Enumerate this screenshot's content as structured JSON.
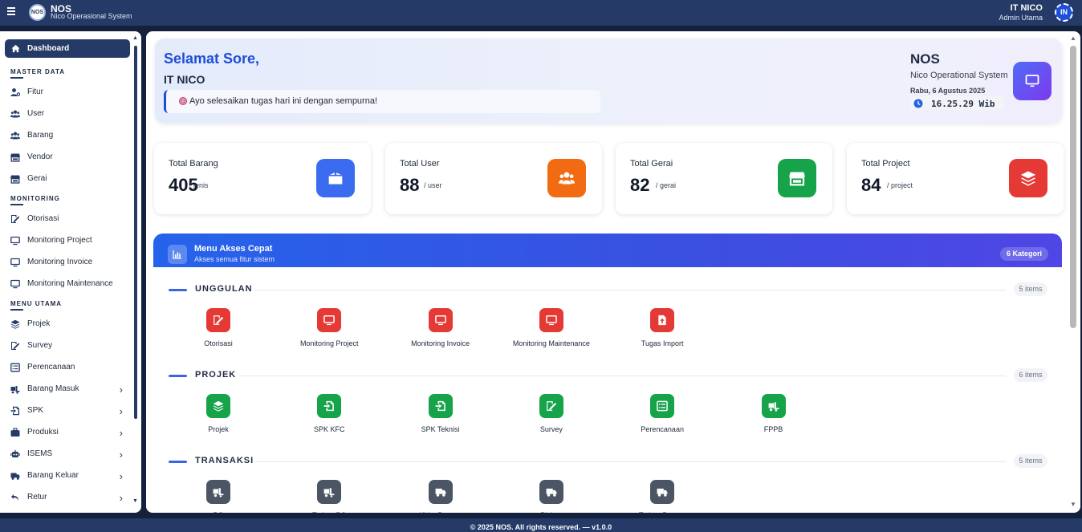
{
  "topbar": {
    "app_name": "NOS",
    "app_subtitle": "Nico Operasional System",
    "logo_text": "NOS",
    "user_name": "IT NICO",
    "user_role": "Admin Utama",
    "avatar_initials": "IN"
  },
  "sidebar": {
    "active": {
      "label": "Dashboard",
      "icon": "home-icon"
    },
    "sections": [
      {
        "title": "MASTER DATA",
        "items": [
          {
            "label": "Fitur",
            "icon": "user-cog-icon"
          },
          {
            "label": "User",
            "icon": "users-icon"
          },
          {
            "label": "Barang",
            "icon": "users-icon"
          },
          {
            "label": "Vendor",
            "icon": "store-icon"
          },
          {
            "label": "Gerai",
            "icon": "store-icon"
          }
        ]
      },
      {
        "title": "MONITORING",
        "items": [
          {
            "label": "Otorisasi",
            "icon": "signature-icon"
          },
          {
            "label": "Monitoring Project",
            "icon": "monitor-icon"
          },
          {
            "label": "Monitoring Invoice",
            "icon": "monitor-icon"
          },
          {
            "label": "Monitoring Maintenance",
            "icon": "monitor-icon"
          }
        ]
      },
      {
        "title": "MENU UTAMA",
        "items": [
          {
            "label": "Projek",
            "icon": "layers-icon"
          },
          {
            "label": "Survey",
            "icon": "signature-icon"
          },
          {
            "label": "Perencanaan",
            "icon": "list-icon"
          },
          {
            "label": "Barang Masuk",
            "icon": "truck-loading-icon",
            "expandable": true
          },
          {
            "label": "SPK",
            "icon": "file-import-icon",
            "expandable": true
          },
          {
            "label": "Produksi",
            "icon": "briefcase-icon",
            "expandable": true
          },
          {
            "label": "ISEMS",
            "icon": "robot-icon",
            "expandable": true
          },
          {
            "label": "Barang Keluar",
            "icon": "truck-icon",
            "expandable": true
          },
          {
            "label": "Retur",
            "icon": "undo-icon",
            "expandable": true
          }
        ]
      }
    ]
  },
  "welcome": {
    "greeting": "Selamat Sore,",
    "user": "IT NICO",
    "message": "Ayo selesaikan tugas hari ini dengan sempurna!",
    "system_short": "NOS",
    "system_name": "Nico Operational System",
    "date": "Rabu, 6 Agustus 2025",
    "time": "16.25.29 Wib"
  },
  "stats": [
    {
      "label": "Total Barang",
      "value": "405",
      "unit": "/ jenis",
      "color": "#3b6cf0",
      "icon": "box-icon"
    },
    {
      "label": "Total User",
      "value": "88",
      "unit": "/ user",
      "color": "#f26b12",
      "icon": "users-icon"
    },
    {
      "label": "Total Gerai",
      "value": "82",
      "unit": "/ gerai",
      "color": "#16a34a",
      "icon": "store-icon"
    },
    {
      "label": "Total Project",
      "value": "84",
      "unit": "/ project",
      "color": "#e53935",
      "icon": "layers-icon"
    }
  ],
  "quick_access": {
    "title": "Menu Akses Cepat",
    "subtitle": "Akses semua fitur sistem",
    "badge": "6 Kategori",
    "categories": [
      {
        "title": "UNGGULAN",
        "count": "5 items",
        "color": "red",
        "items": [
          {
            "label": "Otorisasi",
            "icon": "signature-icon"
          },
          {
            "label": "Monitoring Project",
            "icon": "monitor-icon"
          },
          {
            "label": "Monitoring Invoice",
            "icon": "monitor-icon"
          },
          {
            "label": "Monitoring Maintenance",
            "icon": "monitor-icon"
          },
          {
            "label": "Tugas Import",
            "icon": "file-upload-icon"
          }
        ]
      },
      {
        "title": "PROJEK",
        "count": "6 items",
        "color": "green",
        "items": [
          {
            "label": "Projek",
            "icon": "layers-icon"
          },
          {
            "label": "SPK KFC",
            "icon": "file-import-icon"
          },
          {
            "label": "SPK Teknisi",
            "icon": "file-import-icon"
          },
          {
            "label": "Survey",
            "icon": "signature-icon"
          },
          {
            "label": "Perencanaan",
            "icon": "list-icon"
          },
          {
            "label": "FPPB",
            "icon": "truck-loading-icon"
          }
        ]
      },
      {
        "title": "TRANSAKSI",
        "count": "5 items",
        "color": "slate",
        "items": [
          {
            "label": "PO",
            "icon": "truck-loading-icon"
          },
          {
            "label": "Terima PO",
            "icon": "truck-loading-icon"
          },
          {
            "label": "Kirim Barang",
            "icon": "truck-icon"
          },
          {
            "label": "Pickup",
            "icon": "truck-icon"
          },
          {
            "label": "Terima Barang",
            "icon": "truck-icon"
          }
        ]
      }
    ]
  },
  "footer": {
    "text": "© 2025 NOS. All rights reserved. — v1.0.0"
  }
}
